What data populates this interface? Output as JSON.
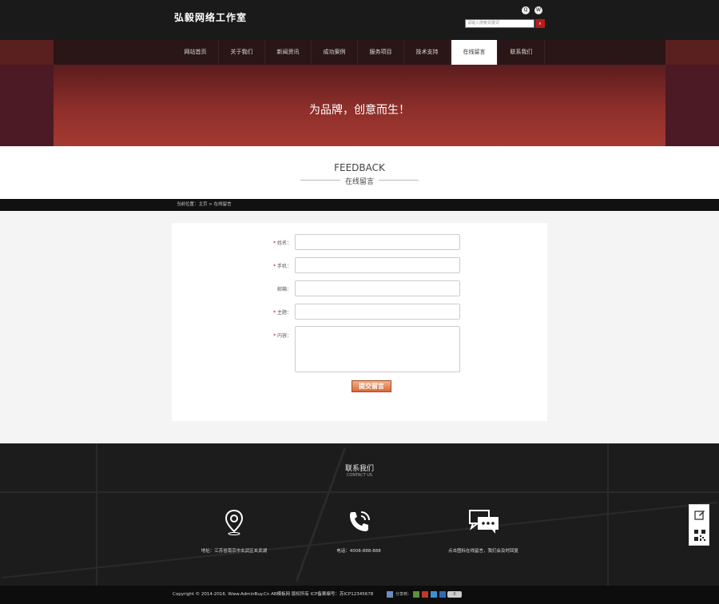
{
  "header": {
    "logo": "弘毅网络工作室",
    "search_placeholder": "请输入搜索关键词",
    "search_icon": "search-icon",
    "top_icons": [
      "qq-icon",
      "weibo-icon"
    ]
  },
  "nav": {
    "items": [
      {
        "label": "网站首页"
      },
      {
        "label": "关于我们"
      },
      {
        "label": "新闻资讯"
      },
      {
        "label": "成功案例"
      },
      {
        "label": "服务项目"
      },
      {
        "label": "技术支持"
      },
      {
        "label": "在线留言"
      },
      {
        "label": "联系我们"
      }
    ],
    "active_index": 6
  },
  "banner": {
    "slogan": "为品牌，创意而生！"
  },
  "feedback": {
    "title_en": "FEEDBACK",
    "title_cn": "在线留言"
  },
  "breadcrumb": {
    "text": "当前位置：主页 > 在线留言"
  },
  "form": {
    "fields": [
      {
        "label": "姓名：",
        "required": true,
        "value": ""
      },
      {
        "label": "手机：",
        "required": true,
        "value": ""
      },
      {
        "label": "邮箱：",
        "required": false,
        "value": ""
      },
      {
        "label": "主题：",
        "required": true,
        "value": ""
      },
      {
        "label": "内容：",
        "required": true,
        "value": ""
      }
    ],
    "submit_label": "提交留言"
  },
  "contact": {
    "title": "联系我们",
    "subtitle": "CONTACT US",
    "items": [
      {
        "icon": "location-pin-icon",
        "text": "地址：江苏省南京市玄武区玄武湖"
      },
      {
        "icon": "phone-icon",
        "text": "电话：4008-888-888"
      },
      {
        "icon": "chat-bubble-icon",
        "text": "点击图标在线留言，我们会及时回复"
      }
    ]
  },
  "copyright": {
    "text": "Copyright © 2014-2016. Www.AdminBuy.Cn AB模板网 版权所有  ICP备案编号：苏ICP12345678",
    "share_label": "分享到：",
    "share_count": "0"
  },
  "colors": {
    "header_bg": "#1a1a1a",
    "accent": "#b51c1c",
    "banner": "#8e2f2b"
  }
}
